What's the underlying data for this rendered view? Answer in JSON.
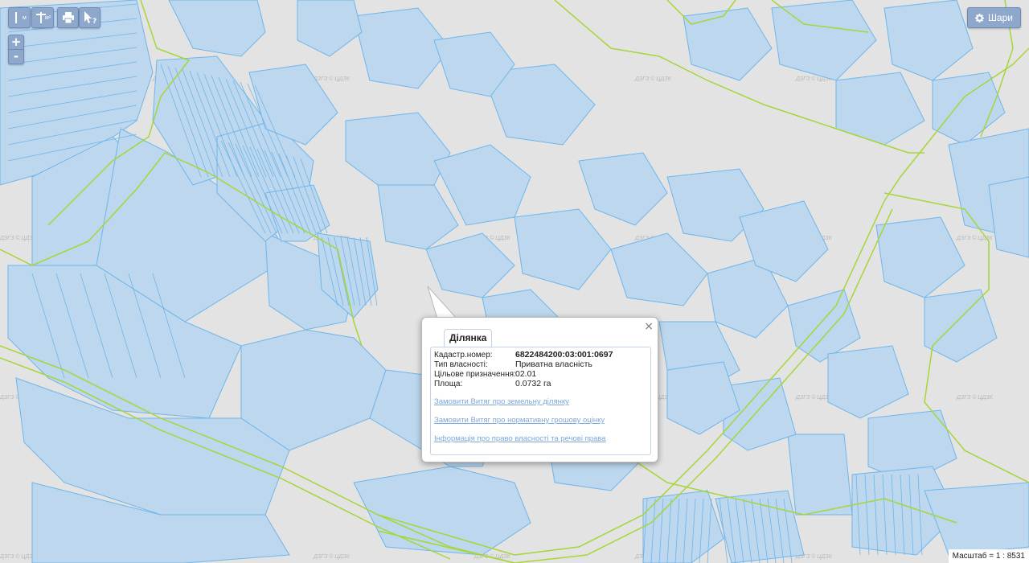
{
  "map": {
    "watermark": "ДЗГЗ © ЦДЗК",
    "colors": {
      "background": "#e3e3e3",
      "parcel_fill": "#bcd7ee",
      "parcel_stroke": "#6fb6ea",
      "boundary": "#a6d63a"
    }
  },
  "toolbar": {
    "measure_length_icon": "ruler-length-icon",
    "measure_length_sub": "м",
    "measure_area_icon": "ruler-area-icon",
    "measure_area_sub": "м²",
    "print_icon": "printer-icon",
    "identify_icon": "cursor-question-icon"
  },
  "zoom": {
    "in_label": "+",
    "out_label": "-"
  },
  "layers": {
    "label": "Шари",
    "icon": "gear-icon"
  },
  "popup": {
    "close": "×",
    "tab": "Ділянка",
    "fields": [
      {
        "label": "Кадастр.номер:",
        "value": "6822484200:03:001:0697"
      },
      {
        "label": "Тип власності:",
        "value": "Приватна власність"
      },
      {
        "label": "Цільове призначення:",
        "value": "02.01"
      },
      {
        "label": "Площа:",
        "value": "0.0732 га"
      }
    ],
    "links": [
      "Замовити Витяг про земельну ділянку",
      "Замовити Витяг про нормативну грошову оцінку",
      "Інформація про право власності та речові права"
    ]
  },
  "scale": {
    "label": "Масштаб = 1 : 8531"
  }
}
